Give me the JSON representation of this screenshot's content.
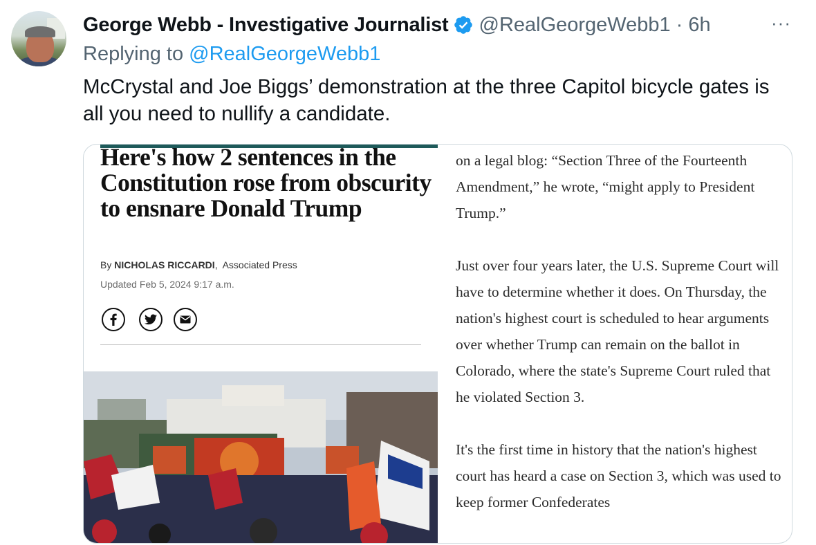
{
  "tweet": {
    "author_name": "George Webb - Investigative Journalist",
    "handle": "@RealGeorgeWebb1",
    "separator": "·",
    "time": "6h",
    "more_label": "···",
    "replying_prefix": "Replying to",
    "replying_handle": "@RealGeorgeWebb1",
    "text": "McCrystal and Joe Biggs’ demonstration at the three Capitol bicycle gates is all you need to nullify a candidate.",
    "verified_color": "#1d9bf0"
  },
  "article": {
    "headline": "Here's how 2 sentences in the Constitution rose from obscurity to ensnare Donald Trump",
    "byline_prefix": "By",
    "author": "NICHOLAS RICCARDI",
    "byline_sep": ",",
    "outlet": "Associated Press",
    "updated": "Updated Feb 5, 2024 9:17 a.m.",
    "share_icons": [
      "facebook-icon",
      "twitter-icon",
      "email-icon"
    ],
    "paragraphs": [
      "on a legal blog: “Section Three of the Fourteenth Amendment,” he wrote, “might apply to President Trump.”",
      "Just over four years later, the U.S. Supreme Court will have to determine whether it does. On Thursday, the nation's highest court is scheduled to hear arguments over whether Trump can remain on the ballot in Colorado, where the state's Supreme Court ruled that he violated Section 3.",
      "It's the first time in history that the nation's highest court has heard a case on Section 3, which was used to keep former Confederates"
    ]
  }
}
